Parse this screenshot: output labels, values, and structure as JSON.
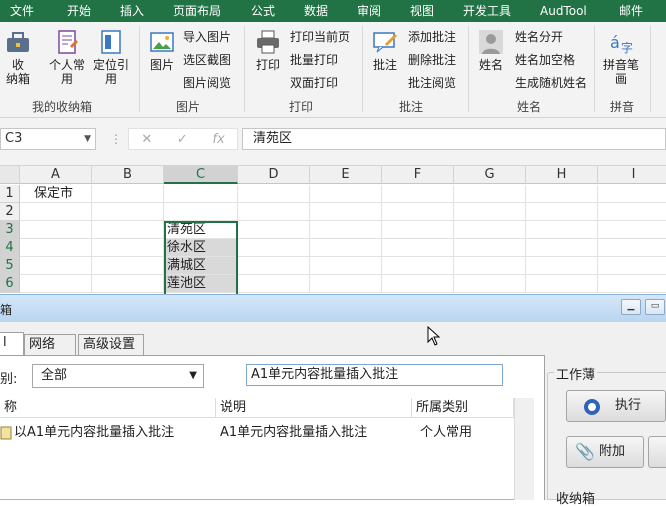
{
  "menu": [
    "文件",
    "开始",
    "插入",
    "页面布局",
    "公式",
    "数据",
    "审阅",
    "视图",
    "开发工具",
    "AudTool",
    "邮件"
  ],
  "ribbon": {
    "btn_collect": "收\n纳箱",
    "btn_personal": "个人常\n用",
    "btn_locate": "定位引\n用",
    "group_mybox": "我的收纳箱",
    "btn_picture": "图片",
    "import_picture": "导入图片",
    "select_screenshot": "选区截图",
    "picture_browse": "图片阅览",
    "group_picture": "图片",
    "btn_print": "打印",
    "print_current_page": "打印当前页",
    "batch_print": "批量打印",
    "duplex_print": "双面打印",
    "group_print": "打印",
    "btn_comment": "批注",
    "add_comment": "添加批注",
    "delete_comment": "删除批注",
    "comment_browse": "批注阅览",
    "group_comment": "批注",
    "btn_name": "姓名",
    "name_split": "姓名分开",
    "name_add_space": "姓名加空格",
    "random_name": "生成随机姓名",
    "group_name": "姓名",
    "btn_pinyin": "拼音笔\n画",
    "group_pinyin": "拼音"
  },
  "formula_bar": {
    "name_box": "C3",
    "cancel": "✕",
    "enter": "✓",
    "fx": "fx",
    "value": "清苑区"
  },
  "columns": [
    "A",
    "B",
    "C",
    "D",
    "E",
    "F",
    "G",
    "H",
    "I"
  ],
  "rows": [
    "1",
    "2",
    "3",
    "4",
    "5",
    "6"
  ],
  "cells": {
    "A1": "保定市",
    "C3": "清苑区",
    "C4": "徐水区",
    "C5": "满城区",
    "C6": "莲池区"
  },
  "dialog": {
    "title": "箱",
    "tabs": [
      "l",
      "网络",
      "高级设置"
    ],
    "category_label": "别:",
    "category_value": "全部",
    "search_value": "A1单元内容批量插入批注",
    "list_headers": [
      "称",
      "说明",
      "所属类别"
    ],
    "list_rows": [
      {
        "name": "以A1单元内容批量插入批注",
        "desc": "A1单元内容批量插入批注",
        "cat": "个人常用"
      }
    ],
    "workbook_group": "工作薄",
    "execute_button": "执行",
    "attach_button": "附加",
    "box_group_partial": "收纳箱"
  },
  "colors": {
    "excel_green": "#217346",
    "selection_green": "#217346",
    "dialog_title": "#c7def5"
  }
}
